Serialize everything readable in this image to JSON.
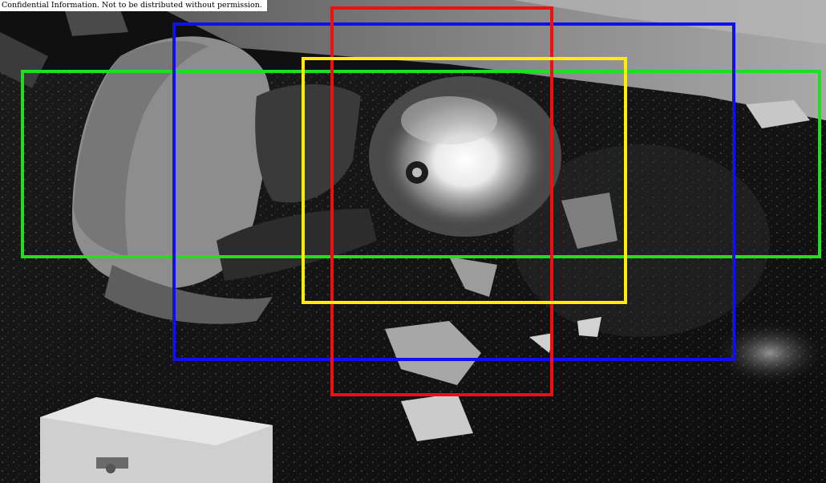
{
  "watermark": {
    "text": "Confidential Information. Not to be distributed without permission."
  },
  "overlay_boxes": [
    {
      "name": "detection-box-green",
      "color": "#22dd22"
    },
    {
      "name": "detection-box-blue",
      "color": "#1010ee"
    },
    {
      "name": "detection-box-red",
      "color": "#ee1010"
    },
    {
      "name": "detection-box-yellow",
      "color": "#ffee00"
    }
  ],
  "scene": {
    "kind": "grayscale night-vision security camera still",
    "subjects": [
      "person-in-hooded-jacket",
      "shattered-glass",
      "light-glare",
      "cabinet"
    ]
  }
}
